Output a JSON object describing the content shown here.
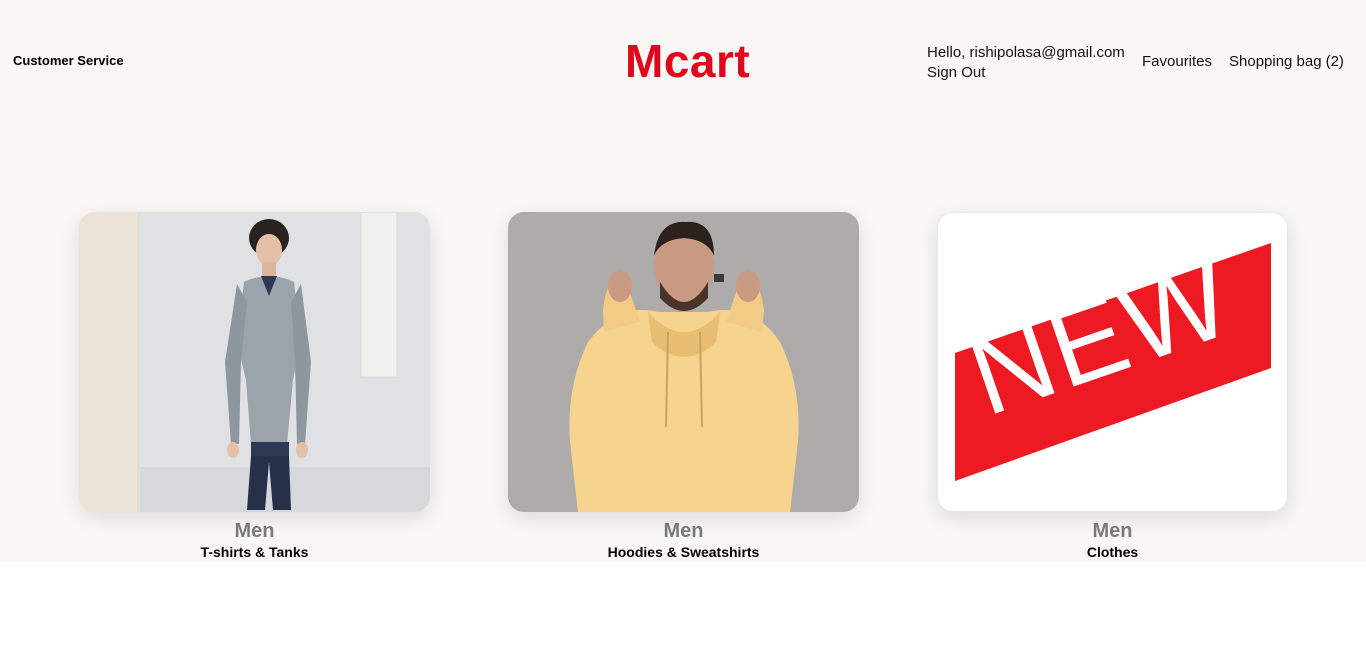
{
  "header": {
    "customer_service": "Customer Service",
    "logo": "Mcart",
    "greeting": "Hello, rishipolasa@gmail.com",
    "sign_out": "Sign Out",
    "favourites": "Favourites",
    "shopping_bag": "Shopping bag",
    "bag_count": "(2)"
  },
  "brand_color": "#e0071c",
  "cards": [
    {
      "category": "Men",
      "subcategory": "T-shirts & Tanks",
      "image": "man-grey-sweater-photo"
    },
    {
      "category": "Men",
      "subcategory": "Hoodies & Sweatshirts",
      "image": "man-yellow-hoodie-photo"
    },
    {
      "category": "Men",
      "subcategory": "Clothes",
      "image": "new-banner",
      "banner_text": "NEW"
    }
  ]
}
